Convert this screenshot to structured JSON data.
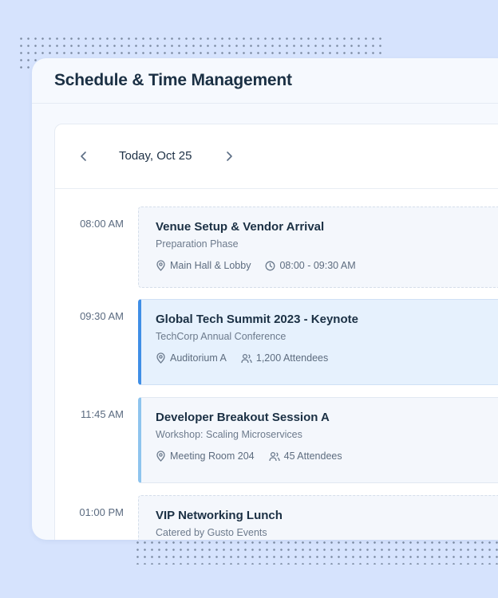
{
  "header": {
    "title": "Schedule & Time Management"
  },
  "date_nav": {
    "label": "Today, Oct 25"
  },
  "events": [
    {
      "time": "08:00 AM",
      "title": "Venue Setup & Vendor Arrival",
      "subtitle": "Preparation Phase",
      "location": "Main Hall & Lobby",
      "detail": "08:00 - 09:30 AM",
      "detail_icon": "clock-icon"
    },
    {
      "time": "09:30 AM",
      "title": "Global Tech Summit 2023 - Keynote",
      "subtitle": "TechCorp Annual Conference",
      "location": "Auditorium A",
      "detail": "1,200 Attendees",
      "detail_icon": "users-icon"
    },
    {
      "time": "11:45 AM",
      "title": "Developer Breakout Session A",
      "subtitle": "Workshop: Scaling Microservices",
      "location": "Meeting Room 204",
      "detail": "45 Attendees",
      "detail_icon": "users-icon"
    },
    {
      "time": "01:00 PM",
      "title": "VIP Networking Lunch",
      "subtitle": "Catered by Gusto Events"
    }
  ],
  "colors": {
    "background": "#d6e3fd",
    "accent": "#3f8ee6",
    "accent_light": "#8ec4ee",
    "title_text": "#1b3044"
  }
}
